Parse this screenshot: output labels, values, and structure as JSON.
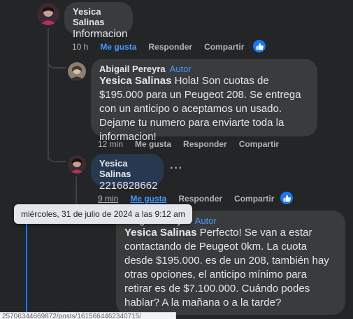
{
  "comments": [
    {
      "author": "Yesica Salinas",
      "text": "Informacion",
      "time": "10 h",
      "like": "Me gusta",
      "reply": "Responder",
      "share": "Compartir"
    },
    {
      "author": "Abigail Pereyra",
      "badge": "Autor",
      "mention": "Yesica Salinas",
      "text": " Hola! Son cuotas de $195.000 para un Peugeot 208. Se entrega con un anticipo o aceptamos un usado. Dejame tu numero para enviarte toda la informacion!",
      "time": "12 min",
      "like": "Me gusta",
      "reply": "Responder",
      "share": "Compartir"
    },
    {
      "author": "Yesica Salinas",
      "text": "2216828662",
      "time": "9 min",
      "like": "Me gusta",
      "reply": "Responder",
      "share": "Compartir"
    },
    {
      "author": "Abigail Pereyra",
      "badge": "Autor",
      "mention": "Yesica Salinas",
      "text": " Perfecto! Se van a estar contactando de Peugeot 0km. La cuota desde $195.000. es de un 208, también hay otras opciones, el anticipo mínimo para retirar es de $7.100.000. Cuándo podes hablar? A la mañana o a la tarde?"
    }
  ],
  "tooltip": "miércoles, 31 de julio de 2024 a las 9:12 am",
  "status_url": "25706344669872/posts/1615664462340715/",
  "more": "···",
  "colors": {
    "background": "#242526",
    "bubble": "#3a3b3c",
    "accent": "#4599ff",
    "like_blue": "#1877f2"
  },
  "icons": [
    "like-reaction-icon",
    "more-options-icon"
  ]
}
